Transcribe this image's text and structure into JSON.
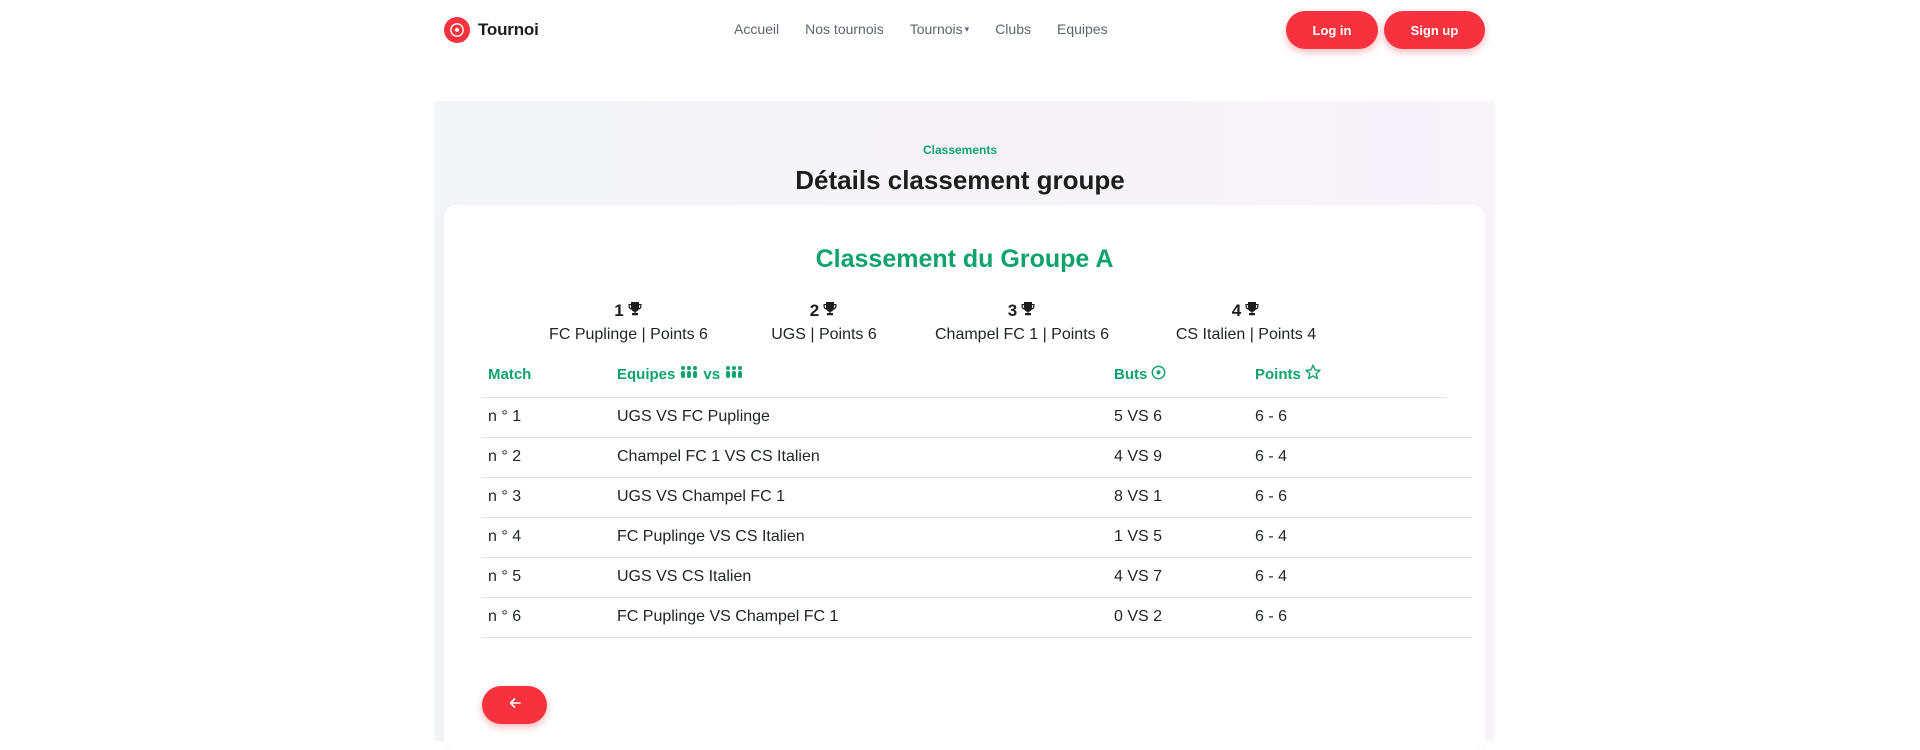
{
  "brand": {
    "name": "Tournoi",
    "logo_icon": "soccer-ball-icon",
    "accent": "#f6323e"
  },
  "nav": {
    "items": [
      {
        "label": "Accueil"
      },
      {
        "label": "Nos tournois"
      },
      {
        "label": "Tournois",
        "has_dropdown": true
      },
      {
        "label": "Clubs"
      },
      {
        "label": "Equipes"
      }
    ]
  },
  "auth": {
    "login_label": "Log in",
    "signup_label": "Sign up"
  },
  "section": {
    "eyebrow": "Classements",
    "title": "Détails classement groupe"
  },
  "group": {
    "title": "Classement du Groupe A",
    "title_color": "#0ea36b",
    "podium": [
      {
        "rank": "1",
        "team": "FC Puplinge | Points 6",
        "icon": "trophy-icon"
      },
      {
        "rank": "2",
        "team": "UGS | Points 6",
        "icon": "trophy-icon"
      },
      {
        "rank": "3",
        "team": "Champel FC 1 | Points 6",
        "icon": "trophy-icon"
      },
      {
        "rank": "4",
        "team": "CS Italien | Points 4",
        "icon": "trophy-icon"
      }
    ]
  },
  "table": {
    "headers": {
      "match": "Match",
      "teams": "Equipes",
      "teams_vs": "vs",
      "teams_icon": "users-icon",
      "buts": "Buts",
      "buts_icon": "soccer-ball-icon",
      "points": "Points",
      "points_icon": "star-outline-icon"
    },
    "rows": [
      {
        "match": "n ° 1",
        "teams": "UGS VS FC Puplinge",
        "buts": "5 VS 6",
        "points": "6 - 6"
      },
      {
        "match": "n ° 2",
        "teams": "Champel FC 1 VS CS Italien",
        "buts": "4 VS 9",
        "points": "6 - 4"
      },
      {
        "match": "n ° 3",
        "teams": "UGS VS Champel FC 1",
        "buts": "8 VS 1",
        "points": "6 - 6"
      },
      {
        "match": "n ° 4",
        "teams": "FC Puplinge VS CS Italien",
        "buts": "1 VS 5",
        "points": "6 - 4"
      },
      {
        "match": "n ° 5",
        "teams": "UGS VS CS Italien",
        "buts": "4 VS 7",
        "points": "6 - 4"
      },
      {
        "match": "n ° 6",
        "teams": "FC Puplinge VS Champel FC 1",
        "buts": "0 VS 2",
        "points": "6 - 6"
      }
    ]
  },
  "back_button": {
    "icon": "arrow-left-icon"
  }
}
